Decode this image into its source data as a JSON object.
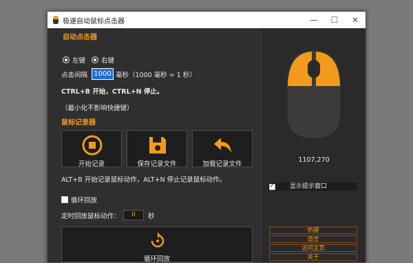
{
  "window": {
    "title": "极速自动鼠标点击器"
  },
  "auto_clicker": {
    "section_title": "自动点击器",
    "left_label": "左键",
    "right_label": "右键",
    "interval_label": "点击间隔",
    "interval_value": "1000",
    "interval_unit": "毫秒（1000 毫秒 = 1 秒）",
    "hotkey_text": "CTRL+B 开始，CTRL+N 停止。",
    "note_text": "（最小化不影响快捷键）"
  },
  "recorder": {
    "section_title": "鼠标记录器",
    "buttons": [
      {
        "label": "开始记录",
        "icon": "record-icon"
      },
      {
        "label": "保存记录文件",
        "icon": "save-icon"
      },
      {
        "label": "加载记录文件",
        "icon": "load-icon"
      }
    ],
    "hotkey_text": "ALT+B 开始记录鼠标动作，ALT+N 停止记录鼠标动作。",
    "loop_label": "循环回放",
    "delay_label": "定时回放鼠标动作：",
    "delay_value": "0",
    "delay_unit": "秒",
    "loop_button_label": "循环回放"
  },
  "right_panel": {
    "coords": "1107,270",
    "show_tip_label": "显示提示窗口",
    "links": [
      "热键",
      "语言",
      "访问主页",
      "关于"
    ]
  },
  "colors": {
    "accent": "#f39a1c",
    "background": "#2f2f2f"
  }
}
